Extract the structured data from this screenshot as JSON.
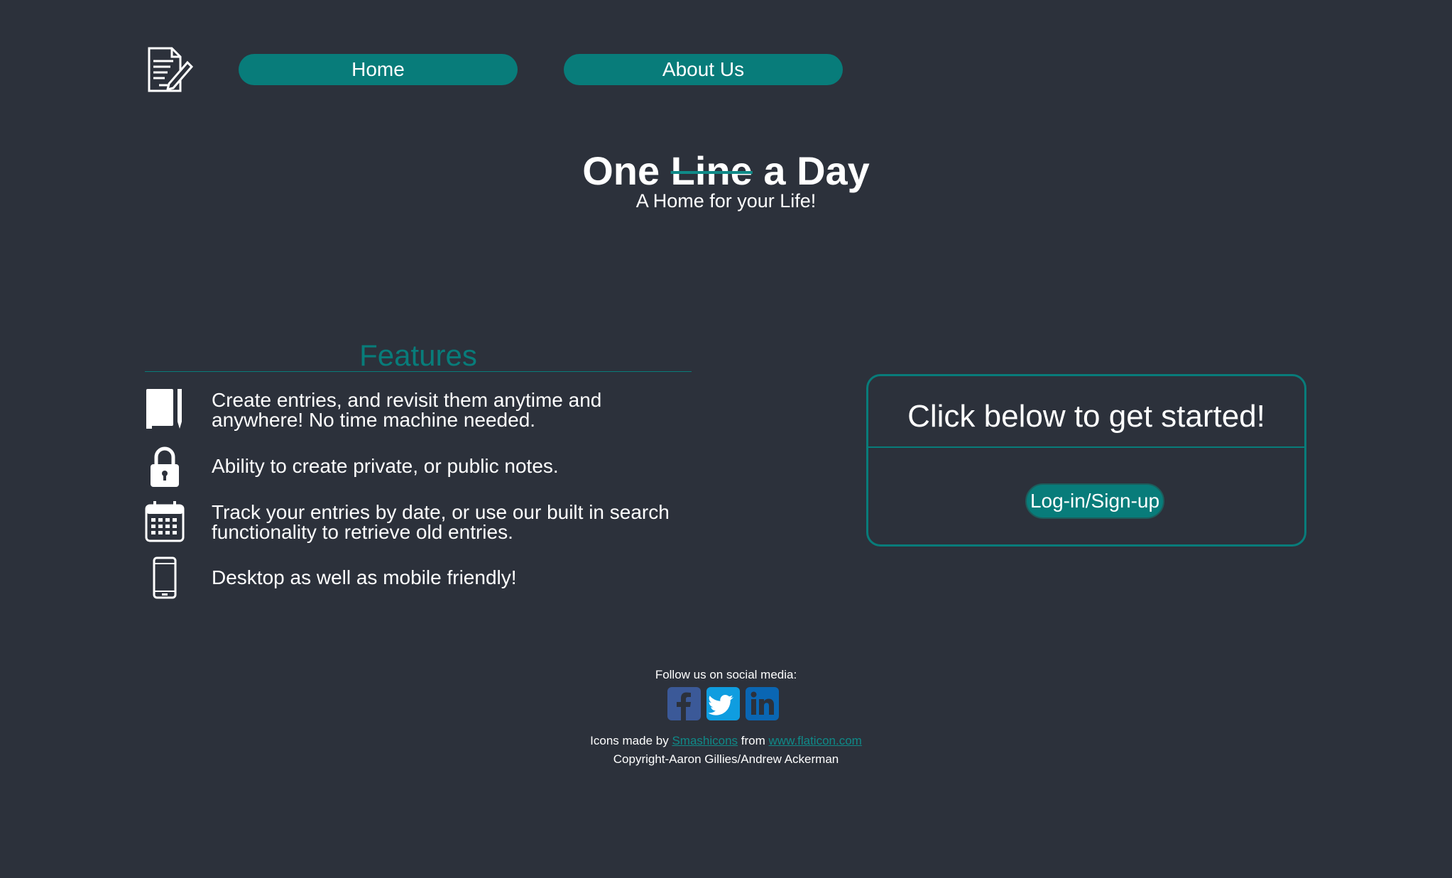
{
  "nav": {
    "logo_icon": "notepad-pen-icon",
    "home_label": "Home",
    "about_label": "About Us"
  },
  "hero": {
    "title_before": "One",
    "title_strike": "Line",
    "title_after": "a Day",
    "subtitle": "A Home for your Life!"
  },
  "features": {
    "heading": "Features",
    "items": [
      {
        "icon": "notebook-pencil-icon",
        "text": "Create entries, and revisit them anytime and anywhere! No time machine needed."
      },
      {
        "icon": "padlock-icon",
        "text": "Ability to create private, or public notes."
      },
      {
        "icon": "calendar-icon",
        "text": "Track your entries by date, or use our built in search functionality to retrieve old entries."
      },
      {
        "icon": "smartphone-icon",
        "text": "Desktop as well as mobile friendly!"
      }
    ]
  },
  "cta": {
    "title": "Click below to get started!",
    "button_label": "Log-in/Sign-up"
  },
  "footer": {
    "follow_label": "Follow us on social media:",
    "social": [
      {
        "icon": "facebook-icon"
      },
      {
        "icon": "twitter-icon"
      },
      {
        "icon": "linkedin-icon"
      }
    ],
    "credits_prefix": "Icons made by",
    "credits_author": "Smashicons",
    "credits_middle": "from",
    "credits_site": "www.flaticon.com",
    "copyright": "Copyright-Aaron Gillies/Andrew Ackerman"
  },
  "colors": {
    "background": "#2c313b",
    "accent": "#087c7a",
    "text": "#ffffff"
  }
}
